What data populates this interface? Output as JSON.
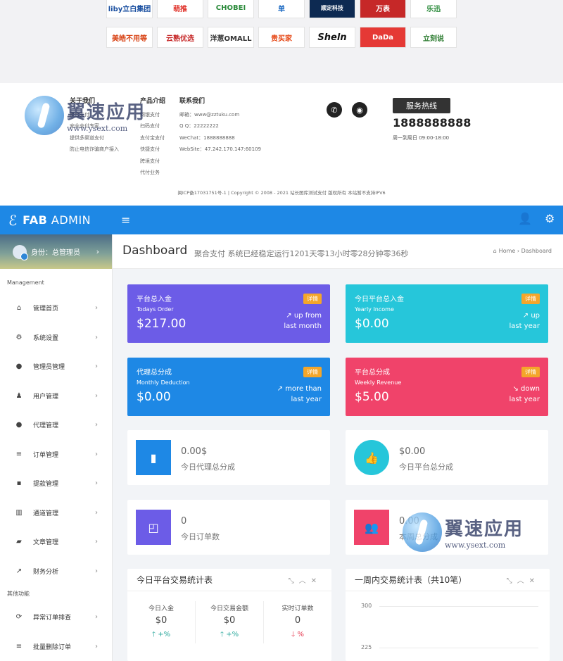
{
  "partner_logos": {
    "row1": [
      "liby立白集团",
      "萌推",
      "CHOBEI",
      "单",
      "顺定科技",
      "万表",
      "乐迅"
    ],
    "row2": [
      "美皓不用等",
      "云熟优选",
      "洋葱OMALL",
      "贵买家",
      "Sheln",
      "DaDa",
      "立刻说"
    ]
  },
  "footer": {
    "about": {
      "title": "关于我们",
      "items": [
        "聚合支付 ",
        "安全支付专家",
        "提供多渠道支付",
        "防止电信诈骗商户接入"
      ]
    },
    "products": {
      "title": "产品介绍",
      "items": [
        "网银支付",
        "扫码支付",
        "支付宝支付",
        "快捷支付",
        "跨境支付",
        "代付业务"
      ]
    },
    "contact": {
      "title": "联系我们",
      "items": [
        "邮箱：www@zztuku.com",
        "Q Q：22222222",
        "WeChat：1888888888",
        "WebSite：47.242.170.147:60109"
      ]
    },
    "hotline_label": "服务热线",
    "hotline_number": "1888888888",
    "hotline_hours": "周一到周日 09:00-18:00",
    "icp": "闽ICP备17031751号-1  |  Copyright © 2008 - 2021 站长图库测试支付 版权所有 本站暂不支持IPV6"
  },
  "watermark": {
    "cn": "翼速应用",
    "en": "www.ysext.com"
  },
  "header": {
    "brand_bold": "FAB",
    "brand_rest": "ADMIN"
  },
  "sidebar": {
    "profile_label": "身份：总管理员",
    "section_management": "Management",
    "items": [
      {
        "icon": "home-icon",
        "glyph": "⌂",
        "label": "管理首页"
      },
      {
        "icon": "cogs-icon",
        "glyph": "⚙",
        "label": "系统设置"
      },
      {
        "icon": "user-circle-icon",
        "glyph": "●",
        "label": "管理员管理"
      },
      {
        "icon": "users-icon",
        "glyph": "♟",
        "label": "用户管理"
      },
      {
        "icon": "agent-icon",
        "glyph": "●",
        "label": "代理管理"
      },
      {
        "icon": "list-icon",
        "glyph": "≡",
        "label": "订单管理"
      },
      {
        "icon": "lock-icon",
        "glyph": "▪",
        "label": "提款管理"
      },
      {
        "icon": "bank-icon",
        "glyph": "▥",
        "label": "通道管理"
      },
      {
        "icon": "book-icon",
        "glyph": "▰",
        "label": "文章管理"
      },
      {
        "icon": "chart-icon",
        "glyph": "↗",
        "label": "财务分析"
      }
    ],
    "section_other": "其他功能",
    "other_items": [
      {
        "icon": "refresh-icon",
        "glyph": "⟳",
        "label": "异常订单排查"
      },
      {
        "icon": "list-icon",
        "glyph": "≡",
        "label": "批量删除订单"
      }
    ]
  },
  "page": {
    "title": "Dashboard",
    "subtitle": "聚合支付 系统已经稳定运行1201天零13小时零28分钟零36秒",
    "breadcrumb_home": "Home",
    "breadcrumb_sep": "›",
    "breadcrumb_current": "Dashboard"
  },
  "stats": [
    {
      "title": "平台总入金",
      "sub": "Todays Order",
      "value": "$217.00",
      "badge": "详情",
      "trend_icon": "↗",
      "trend_line1": "up from",
      "trend_line2": "last month",
      "color": "#6c5ce7"
    },
    {
      "title": "今日平台总入金",
      "sub": "Yearly Income",
      "value": "$0.00",
      "badge": "详情",
      "trend_icon": "↗",
      "trend_line1": "up",
      "trend_line2": "last year",
      "color": "#26c6da"
    },
    {
      "title": "代理总分成",
      "sub": "Monthly Deduction",
      "value": "$0.00",
      "badge": "详情",
      "trend_icon": "↗",
      "trend_line1": "more than",
      "trend_line2": "last year",
      "color": "#1e88e5"
    },
    {
      "title": "平台总分成",
      "sub": "Weekly Revenue",
      "value": "$5.00",
      "badge": "详情",
      "trend_icon": "↘",
      "trend_line1": "down",
      "trend_line2": "last year",
      "color": "#f0436a"
    }
  ],
  "mini_stats": [
    {
      "value": "0.00$",
      "label": "今日代理总分成",
      "icon": "bar-chart-icon",
      "glyph": "▮",
      "color": "#1e88e5"
    },
    {
      "value": "$0.00",
      "label": "今日平台总分成",
      "icon": "thumbs-up-icon",
      "glyph": "👍",
      "color": "#26c6da"
    },
    {
      "value": "0",
      "label": "今日订单数",
      "icon": "shopping-bag-icon",
      "glyph": "◰",
      "color": "#6c5ce7"
    },
    {
      "value": "0.00",
      "label": "本周总分成",
      "icon": "users-icon",
      "glyph": "👥",
      "color": "#f0436a"
    }
  ],
  "panel_today": {
    "title": "今日平台交易统计表",
    "kpis": [
      {
        "label": "今日入金",
        "value": "$0",
        "delta": "+%",
        "dir": "up"
      },
      {
        "label": "今日交易金额",
        "value": "$0",
        "delta": "+%",
        "dir": "up"
      },
      {
        "label": "实时订单数",
        "value": "0",
        "delta": "%",
        "dir": "down"
      }
    ]
  },
  "panel_week": {
    "title": "一周内交易统计表（共10笔）"
  },
  "chart_data": {
    "type": "line",
    "title": "一周内交易统计表（共10笔）",
    "yticks": [
      300,
      225
    ],
    "series": []
  }
}
